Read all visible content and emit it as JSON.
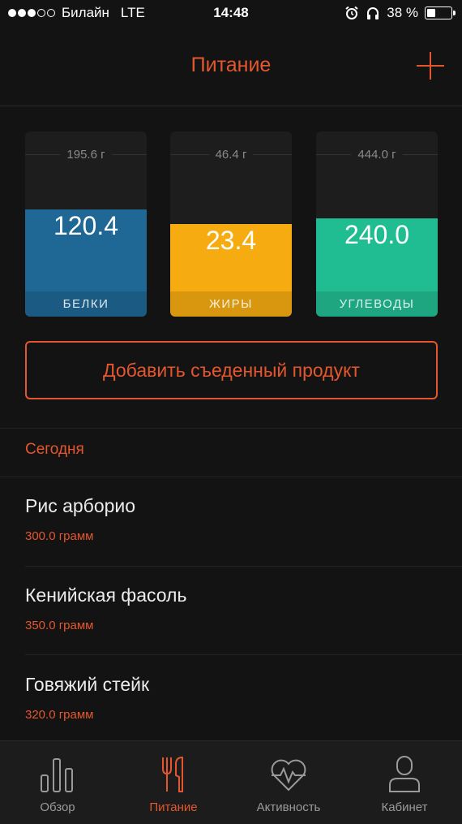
{
  "status_bar": {
    "carrier": "Билайн",
    "network": "LTE",
    "time": "14:48",
    "battery_text": "38 %",
    "battery_level": 0.38
  },
  "nav": {
    "title": "Питание"
  },
  "macros": [
    {
      "goal": "195.6 г",
      "value": "120.4",
      "label": "БЕЛКИ",
      "fraction": 0.58,
      "color": "#1f6896"
    },
    {
      "goal": "46.4 г",
      "value": "23.4",
      "label": "ЖИРЫ",
      "fraction": 0.5,
      "color": "#f6ac11"
    },
    {
      "goal": "444.0 г",
      "value": "240.0",
      "label": "УГЛЕВОДЫ",
      "fraction": 0.53,
      "color": "#21bd92"
    }
  ],
  "add_product_label": "Добавить съеденный продукт",
  "today": {
    "header": "Сегодня",
    "items": [
      {
        "name": "Рис арборио",
        "amount": "300.0 грамм"
      },
      {
        "name": "Кенийская фасоль",
        "amount": "350.0 грамм"
      },
      {
        "name": "Говяжий стейк",
        "amount": "320.0 грамм"
      }
    ]
  },
  "tabs": [
    {
      "label": "Обзор",
      "icon": "bar-chart-icon",
      "active": false
    },
    {
      "label": "Питание",
      "icon": "fork-knife-icon",
      "active": true
    },
    {
      "label": "Активность",
      "icon": "heart-pulse-icon",
      "active": false
    },
    {
      "label": "Кабинет",
      "icon": "person-icon",
      "active": false
    }
  ],
  "colors": {
    "accent": "#e4572e",
    "background": "#131313"
  }
}
